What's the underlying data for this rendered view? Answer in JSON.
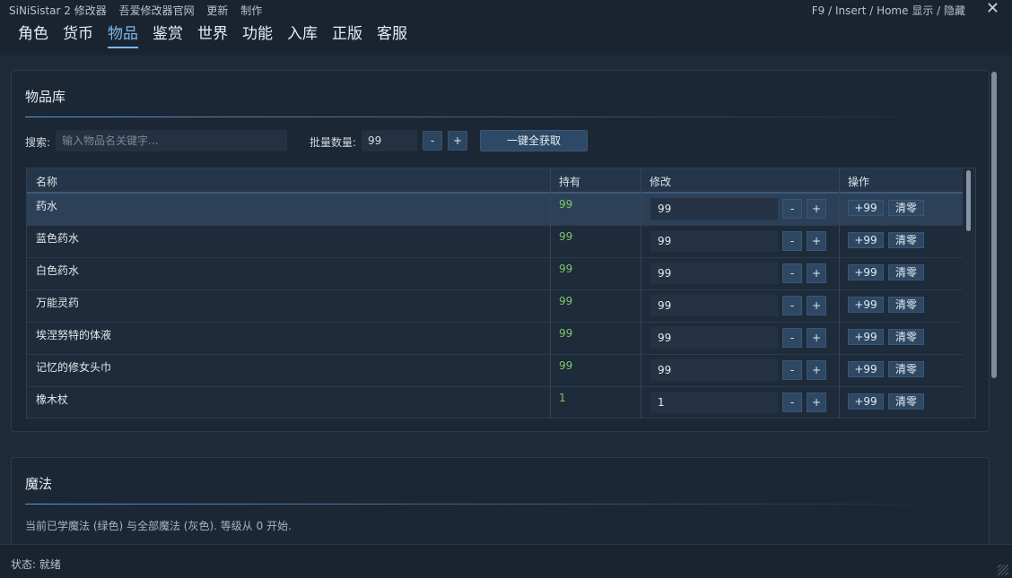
{
  "titlebar": {
    "app": "SiNiSistar 2 修改器",
    "site": "吾爱修改器官网",
    "update": "更新",
    "make": "制作",
    "hotkey": "F9 / Insert / Home  显示 / 隐藏",
    "close": "✕"
  },
  "tabs": [
    "角色",
    "货币",
    "物品",
    "鉴赏",
    "世界",
    "功能",
    "入库",
    "正版",
    "客服"
  ],
  "active_tab": "物品",
  "items_panel": {
    "title": "物品库",
    "search_label": "搜索:",
    "search_placeholder": "输入物品名关键字...",
    "batch_label": "批量数量:",
    "batch_value": "99",
    "minus": "-",
    "plus": "+",
    "get_all": "一键全获取",
    "columns": [
      "名称",
      "持有",
      "修改",
      "操作"
    ],
    "add_label": "+99",
    "clear_label": "清零",
    "rows": [
      {
        "name": "药水",
        "own": "99",
        "edit": "99"
      },
      {
        "name": "蓝色药水",
        "own": "99",
        "edit": "99"
      },
      {
        "name": "白色药水",
        "own": "99",
        "edit": "99"
      },
      {
        "name": "万能灵药",
        "own": "99",
        "edit": "99"
      },
      {
        "name": "埃涅努特的体液",
        "own": "99",
        "edit": "99"
      },
      {
        "name": "记忆的修女头巾",
        "own": "99",
        "edit": "99"
      },
      {
        "name": "橡木杖",
        "own": "1",
        "edit": "1"
      }
    ]
  },
  "magic_panel": {
    "title": "魔法",
    "desc": "当前已学魔法 (绿色) 与全部魔法 (灰色). 等级从 0 开始."
  },
  "status": "状态: 就绪",
  "colors": {
    "accent": "#7fb7e8",
    "own_green": "#7ec86a",
    "background": "#1e2a38"
  }
}
